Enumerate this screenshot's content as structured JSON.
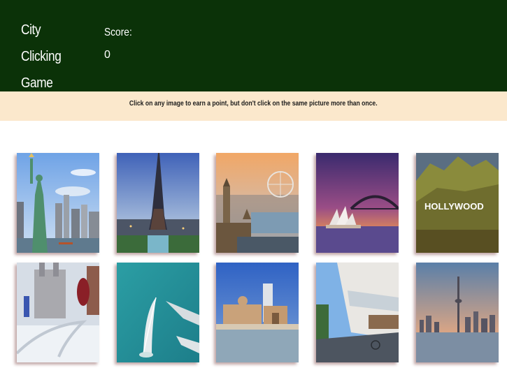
{
  "header": {
    "title": "City Clicking Game",
    "score_label": "Score:",
    "score_value": "0"
  },
  "instructions": "Click on any image to earn a point, but don't click on the same picture more than once.",
  "colors": {
    "header_bg": "#0b3208",
    "instructions_bg": "#fbe8cc"
  },
  "cards": [
    {
      "subject": "statue-of-liberty-new-york"
    },
    {
      "subject": "eiffel-tower-paris"
    },
    {
      "subject": "big-ben-london-eye-london"
    },
    {
      "subject": "sydney-opera-house-harbour-bridge"
    },
    {
      "subject": "hollywood-sign-los-angeles",
      "sign_text": "HOLLYWOOD"
    },
    {
      "subject": "snowy-city-sculpture"
    },
    {
      "subject": "burj-al-arab-dubai"
    },
    {
      "subject": "gateway-of-india-mumbai"
    },
    {
      "subject": "city-street-shops"
    },
    {
      "subject": "cn-tower-toronto-skyline"
    }
  ]
}
